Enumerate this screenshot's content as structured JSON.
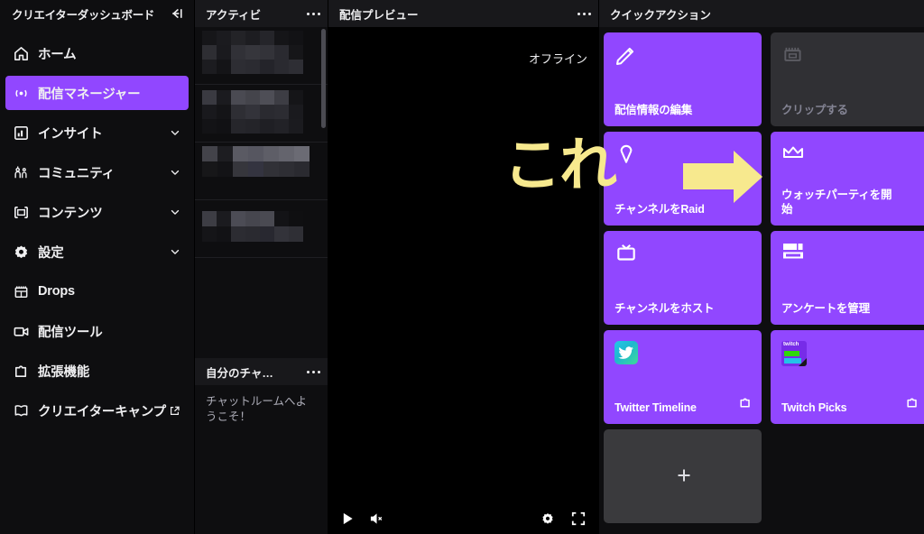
{
  "sidebar": {
    "title": "クリエイターダッシュボード",
    "collapse_icon": "collapse-left-icon",
    "items": [
      {
        "label": "ホーム",
        "icon": "home-icon",
        "active": false,
        "chevron": false,
        "external": false
      },
      {
        "label": "配信マネージャー",
        "icon": "broadcast-icon",
        "active": true,
        "chevron": false,
        "external": false
      },
      {
        "label": "インサイト",
        "icon": "bar-chart-icon",
        "active": false,
        "chevron": true,
        "external": false
      },
      {
        "label": "コミュニティ",
        "icon": "community-icon",
        "active": false,
        "chevron": true,
        "external": false
      },
      {
        "label": "コンテンツ",
        "icon": "content-frame-icon",
        "active": false,
        "chevron": true,
        "external": false
      },
      {
        "label": "設定",
        "icon": "gear-icon",
        "active": false,
        "chevron": true,
        "external": false
      },
      {
        "label": "Drops",
        "icon": "drops-icon",
        "active": false,
        "chevron": false,
        "external": false
      },
      {
        "label": "配信ツール",
        "icon": "video-camera-icon",
        "active": false,
        "chevron": false,
        "external": false
      },
      {
        "label": "拡張機能",
        "icon": "extensions-puzzle-icon",
        "active": false,
        "chevron": false,
        "external": false
      },
      {
        "label": "クリエイターキャンプ",
        "icon": "book-icon",
        "active": false,
        "chevron": false,
        "external": true
      }
    ]
  },
  "activity_panel": {
    "title": "アクティビ",
    "more_icon": "more-options-icon",
    "content_note": "（モザイク処理された配信アクティビティ一覧）",
    "rows": 4
  },
  "chat_panel": {
    "title": "自分のチャ…",
    "more_icon": "more-options-icon",
    "welcome_message": "チャットルームへようこそ！"
  },
  "preview_panel": {
    "title": "配信プレビュー",
    "more_icon": "more-options-icon",
    "status": "オフライン",
    "controls": {
      "play": "play-icon",
      "mute": "volume-muted-icon",
      "settings": "gear-icon",
      "fullscreen": "fullscreen-icon"
    }
  },
  "quick_actions": {
    "title": "クイックアクション",
    "more_icon": "more-options-icon",
    "add_label": "+",
    "tiles": [
      {
        "label": "配信情報の編集",
        "icon": "pencil-icon",
        "state": "enabled",
        "external": false
      },
      {
        "label": "クリップする",
        "icon": "clip-icon",
        "state": "disabled",
        "external": false
      },
      {
        "label": "チャンネルをRaid",
        "icon": "raid-icon",
        "state": "enabled",
        "external": false
      },
      {
        "label": "ウォッチパーティを開始",
        "icon": "crown-icon",
        "state": "enabled",
        "external": false
      },
      {
        "label": "チャンネルをホスト",
        "icon": "host-tv-icon",
        "state": "enabled",
        "external": false
      },
      {
        "label": "アンケートを管理",
        "icon": "poll-icon",
        "state": "enabled",
        "external": false
      },
      {
        "label": "Twitter Timeline",
        "icon": "twitter-bird-icon",
        "state": "enabled",
        "external": true
      },
      {
        "label": "Twitch Picks",
        "icon": "twitch-picks-icon",
        "state": "enabled",
        "external": true
      }
    ]
  },
  "annotation": {
    "text": "これ",
    "arrow": "⇒",
    "color": "#f7e98e"
  },
  "colors": {
    "accent_purple": "#9147ff",
    "panel_background": "#18181b",
    "app_background": "#0e0e10",
    "text_primary": "#efeff1",
    "text_muted": "#adadb8",
    "annotation_yellow": "#f7e98e"
  }
}
